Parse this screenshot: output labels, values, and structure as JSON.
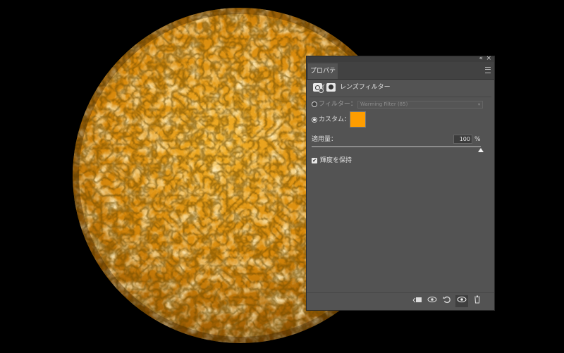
{
  "panel": {
    "collapse_glyph": "«",
    "close_glyph": "×",
    "tab_label": "プロパティ",
    "menu_icon": "panel-menu-icon",
    "header": {
      "adjustment_icon": "adjustment-camera-icon",
      "mask_icon": "layer-mask-icon",
      "title": "レンズフィルター"
    },
    "filter_option": {
      "label": "フィルター：",
      "value": "Warming Filter (85)",
      "selected": false
    },
    "custom_option": {
      "label": "カスタム：",
      "selected": true,
      "color": "#ff9d00"
    },
    "density": {
      "label": "適用量：",
      "value": "100",
      "unit": "%",
      "level": 1.0
    },
    "preserve_luminosity": {
      "label": "輝度を保持",
      "checked": true
    },
    "footer_buttons": [
      {
        "name": "clip-to-layer-icon",
        "glyph": "⬚"
      },
      {
        "name": "view-previous-state-icon",
        "glyph": "◉"
      },
      {
        "name": "reset-icon",
        "glyph": "↺"
      },
      {
        "name": "visibility-eye-icon",
        "glyph": "👁"
      },
      {
        "name": "delete-trash-icon",
        "glyph": "🗑"
      }
    ]
  },
  "colors": {
    "planet": "#e89a12",
    "panel_bg": "#535353",
    "accent_swatch": "#ff9d00"
  }
}
